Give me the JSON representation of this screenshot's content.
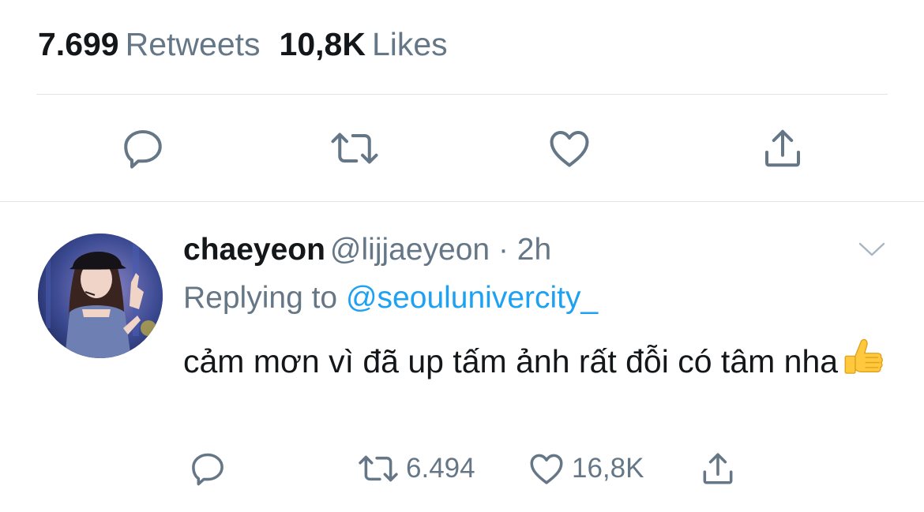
{
  "stats": {
    "retweets_count": "7.699",
    "retweets_label": "Retweets",
    "likes_count": "10,8K",
    "likes_label": "Likes"
  },
  "main_actions": {
    "icons": [
      "reply-icon",
      "retweet-icon",
      "like-icon",
      "share-icon"
    ]
  },
  "reply": {
    "display_name": "chaeyeon",
    "handle_time": "@lijjaeyeon · 2h",
    "replying_prefix": "Replying to",
    "replying_to": "@seoulunivercity_",
    "text": "cảm mơn vì đã up tấm ảnh rất đỗi có tâm nha",
    "emoji": "thumbs-up",
    "retweets": "6.494",
    "likes": "16,8K"
  },
  "colors": {
    "text_primary": "#14171a",
    "text_secondary": "#657786",
    "link": "#1da1f2",
    "divider": "#dfe4e8"
  }
}
